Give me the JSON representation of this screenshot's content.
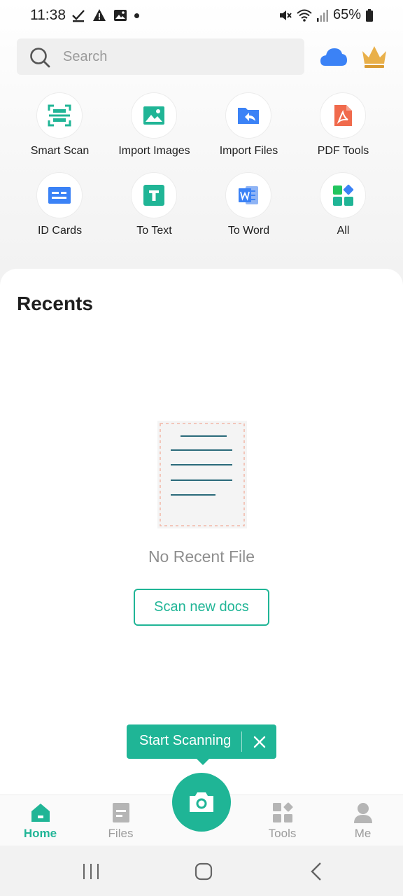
{
  "status_bar": {
    "time": "11:38",
    "battery": "65%"
  },
  "search": {
    "placeholder": "Search"
  },
  "colors": {
    "accent": "#20b596",
    "cloud": "#3b82f6",
    "crown": "#e3a53a"
  },
  "tools": [
    {
      "label": "Smart Scan",
      "icon": "smart-scan-icon"
    },
    {
      "label": "Import Images",
      "icon": "import-images-icon"
    },
    {
      "label": "Import Files",
      "icon": "import-files-icon"
    },
    {
      "label": "PDF Tools",
      "icon": "pdf-tools-icon"
    },
    {
      "label": "ID Cards",
      "icon": "id-cards-icon"
    },
    {
      "label": "To Text",
      "icon": "to-text-icon"
    },
    {
      "label": "To Word",
      "icon": "to-word-icon"
    },
    {
      "label": "All",
      "icon": "all-tools-icon"
    }
  ],
  "recents": {
    "title": "Recents",
    "empty_text": "No Recent File",
    "scan_button": "Scan new docs"
  },
  "tooltip": {
    "label": "Start Scanning"
  },
  "bottom_nav": {
    "items": [
      {
        "label": "Home",
        "icon": "home-icon",
        "active": true
      },
      {
        "label": "Files",
        "icon": "files-icon",
        "active": false
      },
      {
        "label": "Tools",
        "icon": "tools-icon",
        "active": false
      },
      {
        "label": "Me",
        "icon": "person-icon",
        "active": false
      }
    ]
  }
}
